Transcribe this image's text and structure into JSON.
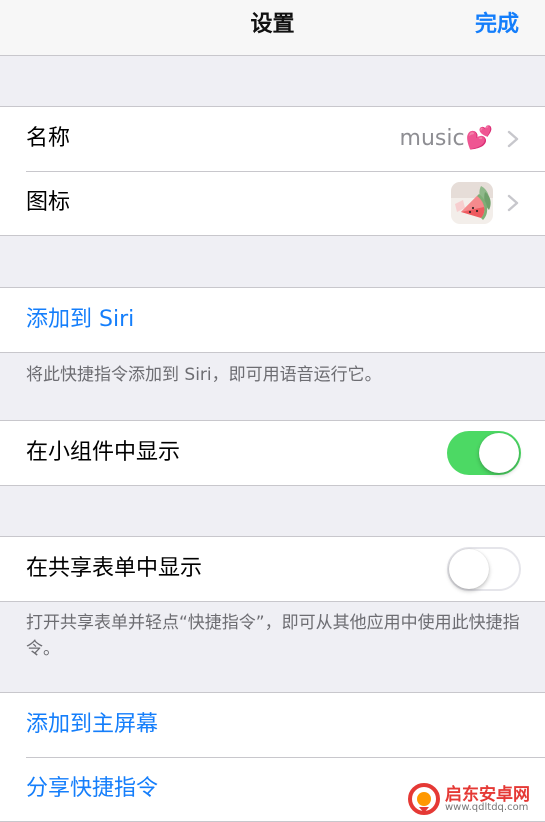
{
  "nav": {
    "title": "设置",
    "done_label": "完成"
  },
  "name_row": {
    "label": "名称",
    "value": "music",
    "emoji": "💕"
  },
  "icon_row": {
    "label": "图标",
    "icon": "watermelon-app-icon"
  },
  "siri": {
    "label": "添加到 Siri",
    "footnote": "将此快捷指令添加到 Siri，即可用语音运行它。"
  },
  "widget": {
    "label": "在小组件中显示",
    "enabled": true
  },
  "share_sheet": {
    "label": "在共享表单中显示",
    "enabled": false,
    "footnote": "打开共享表单并轻点“快捷指令”，即可从其他应用中使用此快捷指令。"
  },
  "actions": {
    "home_screen_label": "添加到主屏幕",
    "share_label": "分享快捷指令"
  },
  "watermark": {
    "name": "启东安卓网",
    "url": "www.qdltdq.com"
  },
  "colors": {
    "accent": "#147efb",
    "toggle_on": "#4cd964",
    "background": "#efeff4",
    "watermark": "#e53935"
  }
}
